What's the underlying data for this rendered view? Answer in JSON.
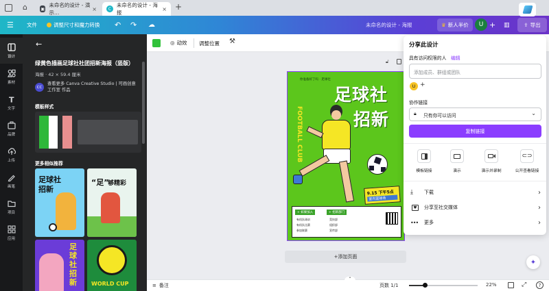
{
  "browser": {
    "tabs": [
      {
        "label": "未命名的设计 - 演示…",
        "active": false
      },
      {
        "label": "未命名的设计 - 海报",
        "active": true
      }
    ],
    "new_tab": "+"
  },
  "header": {
    "menu_icon": "menu-icon",
    "file_label": "文件",
    "resize_label": "调整尺寸和魔力转换",
    "doc_title": "未命名的设计 - 海报",
    "new_user_label": "新人半价",
    "avatar_letter": "U",
    "export_label": "导出"
  },
  "rail": {
    "items": [
      {
        "label": "设计",
        "icon": "design-icon"
      },
      {
        "label": "素材",
        "icon": "elements-icon"
      },
      {
        "label": "文字",
        "icon": "text-icon"
      },
      {
        "label": "品牌",
        "icon": "brand-icon"
      },
      {
        "label": "上传",
        "icon": "upload-icon"
      },
      {
        "label": "画笔",
        "icon": "draw-icon"
      },
      {
        "label": "项目",
        "icon": "folder-icon"
      },
      {
        "label": "应用",
        "icon": "apps-icon"
      }
    ]
  },
  "panel": {
    "template_title": "绿黄色插画足球社社团招新海报（竖版）",
    "template_size": "海报 · 42 × 59.4 厘米",
    "author_text": "查看更多 Canva Creative Studio | 可画创意工作室 作品",
    "author_badge": "CC",
    "styles_heading": "模板样式",
    "more_heading": "更多相似推荐",
    "thumbs": [
      {
        "line1": "足球社",
        "line2": "招新"
      },
      {
        "line1": "“足”",
        "line2": "够精彩"
      },
      {
        "line1": "足球社招新",
        "line2": ""
      },
      {
        "line1": "WORLD CUP",
        "line2": ""
      }
    ],
    "style_colors": [
      "#2eb83a",
      "#ffffff",
      "#e88f8f",
      "#3a3b3d"
    ]
  },
  "canvas_toolbar": {
    "color_swatch": "#31c23b",
    "animate_label": "动效",
    "position_label": "调整位置"
  },
  "poster": {
    "title1": "足球社",
    "title2": "招新",
    "vertical_text": "FOOTBALL CLUB",
    "small_label": "9.15 下午5点",
    "small_label2": "室内篮球场",
    "join_label": "+ 如果加入",
    "dept_label": "+ 招新部门",
    "list_left": [
      "有机队球训",
      "有机队比赛",
      "参加联赛"
    ],
    "list_right": [
      "竞技部",
      "组织部",
      "宣传部"
    ],
    "top_line": "你准备好了吗 · 足球社"
  },
  "canvas": {
    "add_page_label": "+添加页面"
  },
  "bottom": {
    "notes_label": "备注",
    "page_label": "页数 1/1",
    "zoom_label": "22%",
    "zoom_fraction": 0.22
  },
  "share": {
    "title": "分享此设计",
    "access_label": "具有访问权限的人",
    "edit_link": "编辑",
    "input_placeholder": "添加成员、群组或团队",
    "avatar_letter": "U",
    "collab_label": "协作链接",
    "access_option": "只有你可以访问",
    "copy_label": "复制链接",
    "actions": [
      {
        "label": "模板链接",
        "icon": "template-icon"
      },
      {
        "label": "演示",
        "icon": "present-icon"
      },
      {
        "label": "演示并录制",
        "icon": "record-icon"
      },
      {
        "label": "公开查看链接",
        "icon": "link-icon"
      }
    ],
    "rows": [
      {
        "label": "下载",
        "icon": "download-icon"
      },
      {
        "label": "分享至社交媒体",
        "icon": "heart-icon"
      },
      {
        "label": "更多",
        "icon": "more-icon"
      }
    ]
  },
  "colors": {
    "accent": "#8b3dff",
    "poster_green": "#5cc61c",
    "poster_yellow": "#f5e625"
  }
}
